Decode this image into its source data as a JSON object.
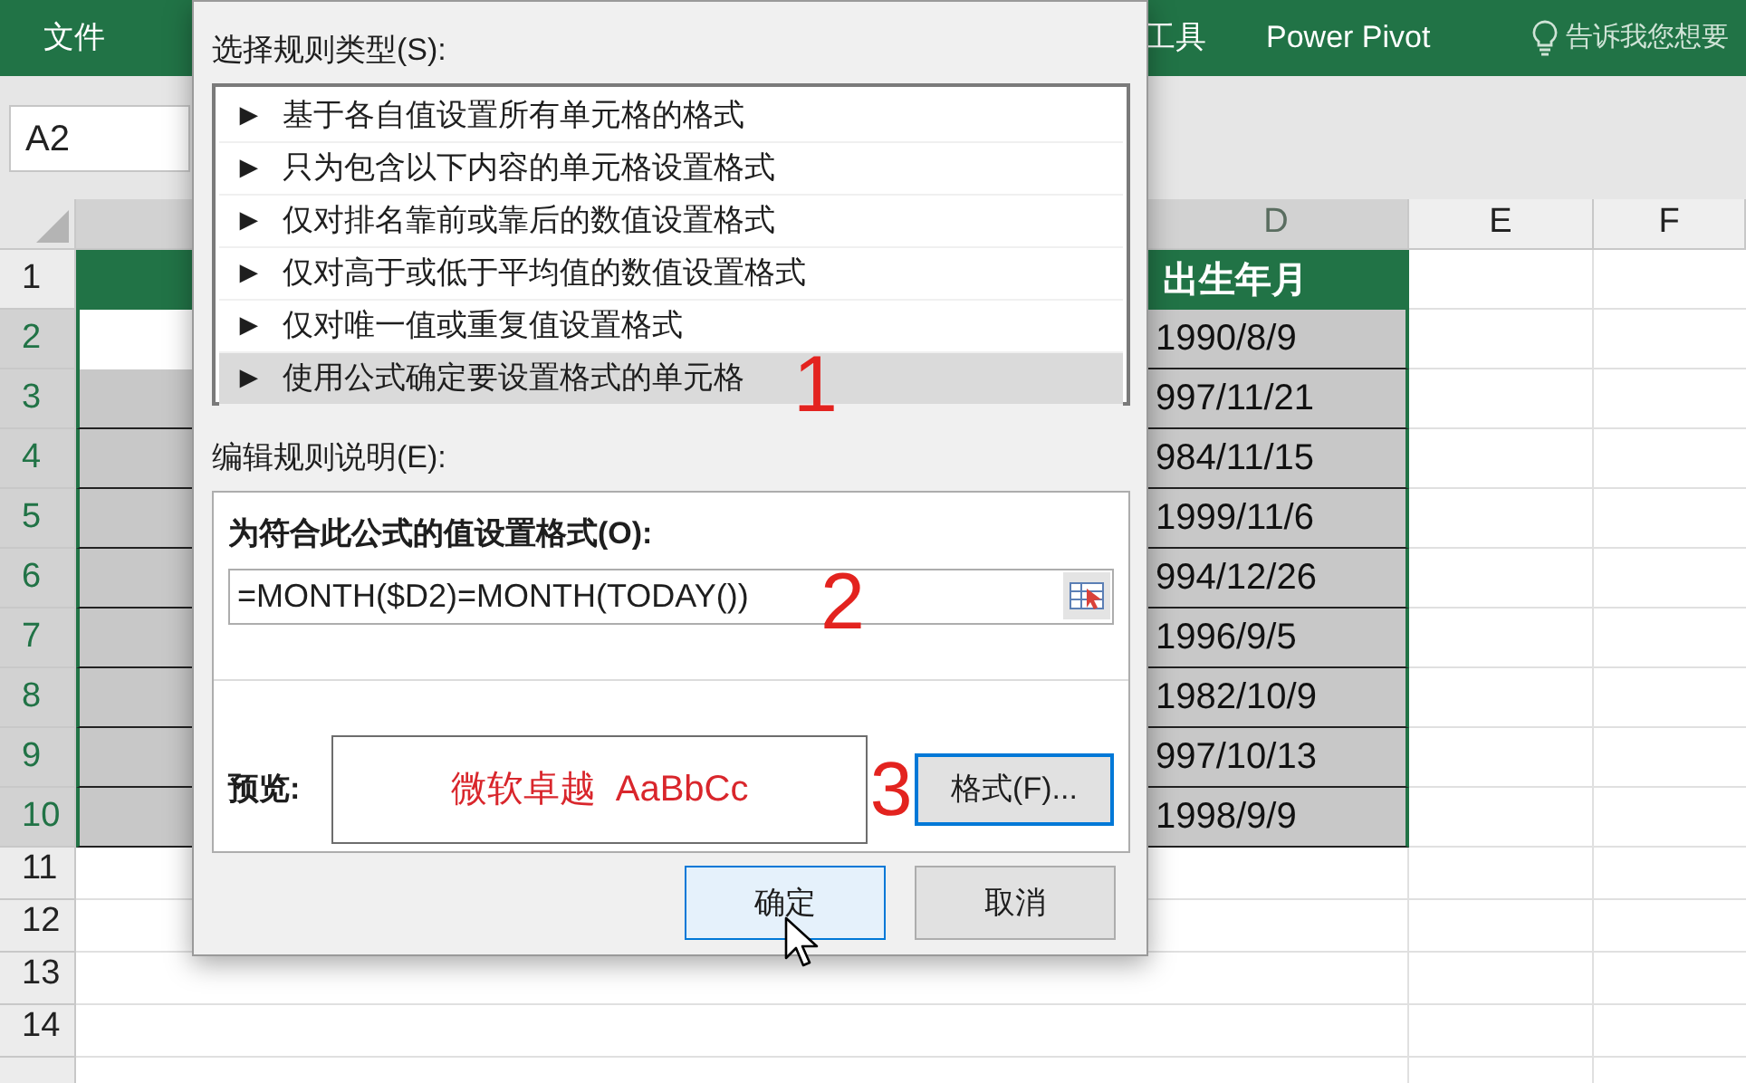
{
  "ribbon": {
    "tabs": [
      {
        "label": "文件",
        "kind": "tab"
      },
      {
        "label": "工具",
        "kind": "tab"
      },
      {
        "label": "Power Pivot",
        "kind": "tab"
      },
      {
        "label": "告诉我您想要",
        "kind": "tellme"
      }
    ]
  },
  "name_box": "A2",
  "sheet": {
    "columns": [
      {
        "label": "D",
        "selected": true
      },
      {
        "label": "E",
        "selected": false
      },
      {
        "label": "F",
        "selected": false
      }
    ],
    "rows": [
      {
        "number": "1",
        "kind": "header",
        "selected": false,
        "d": "出生年月"
      },
      {
        "number": "2",
        "kind": "data",
        "selected": true,
        "active": true,
        "d": "1990/8/9"
      },
      {
        "number": "3",
        "kind": "data",
        "selected": true,
        "active": false,
        "d": "997/11/21"
      },
      {
        "number": "4",
        "kind": "data",
        "selected": true,
        "active": false,
        "d": "984/11/15"
      },
      {
        "number": "5",
        "kind": "data",
        "selected": true,
        "active": false,
        "d": "1999/11/6"
      },
      {
        "number": "6",
        "kind": "data",
        "selected": true,
        "active": false,
        "d": "994/12/26"
      },
      {
        "number": "7",
        "kind": "data",
        "selected": true,
        "active": false,
        "d": "1996/9/5"
      },
      {
        "number": "8",
        "kind": "data",
        "selected": true,
        "active": false,
        "d": "1982/10/9"
      },
      {
        "number": "9",
        "kind": "data",
        "selected": true,
        "active": false,
        "d": "997/10/13"
      },
      {
        "number": "10",
        "kind": "data",
        "selected": true,
        "active": false,
        "d": "1998/9/9"
      },
      {
        "number": "11",
        "kind": "empty",
        "selected": false
      },
      {
        "number": "12",
        "kind": "empty",
        "selected": false
      },
      {
        "number": "13",
        "kind": "empty",
        "selected": false
      },
      {
        "number": "14",
        "kind": "empty",
        "selected": false
      },
      {
        "kind": "empty",
        "selected": false
      }
    ]
  },
  "dialog": {
    "rule_type_label": "选择规则类型(S):",
    "rule_types": [
      {
        "label": "基于各自值设置所有单元格的格式",
        "selected": false
      },
      {
        "label": "只为包含以下内容的单元格设置格式",
        "selected": false
      },
      {
        "label": "仅对排名靠前或靠后的数值设置格式",
        "selected": false
      },
      {
        "label": "仅对高于或低于平均值的数值设置格式",
        "selected": false
      },
      {
        "label": "仅对唯一值或重复值设置格式",
        "selected": false
      },
      {
        "label": "使用公式确定要设置格式的单元格",
        "selected": true
      }
    ],
    "bullet": "►",
    "edit_label": "编辑规则说明(E):",
    "formula_label": "为符合此公式的值设置格式(O):",
    "formula": "=MONTH($D2)=MONTH(TODAY())",
    "preview_label": "预览:",
    "preview_text": "微软卓越  AaBbCc",
    "format_button": "格式(F)...",
    "buttons": [
      {
        "label": "确定",
        "kind": "default"
      },
      {
        "label": "取消",
        "kind": "normal"
      }
    ]
  },
  "annotations": [
    "1",
    "2",
    "3"
  ]
}
